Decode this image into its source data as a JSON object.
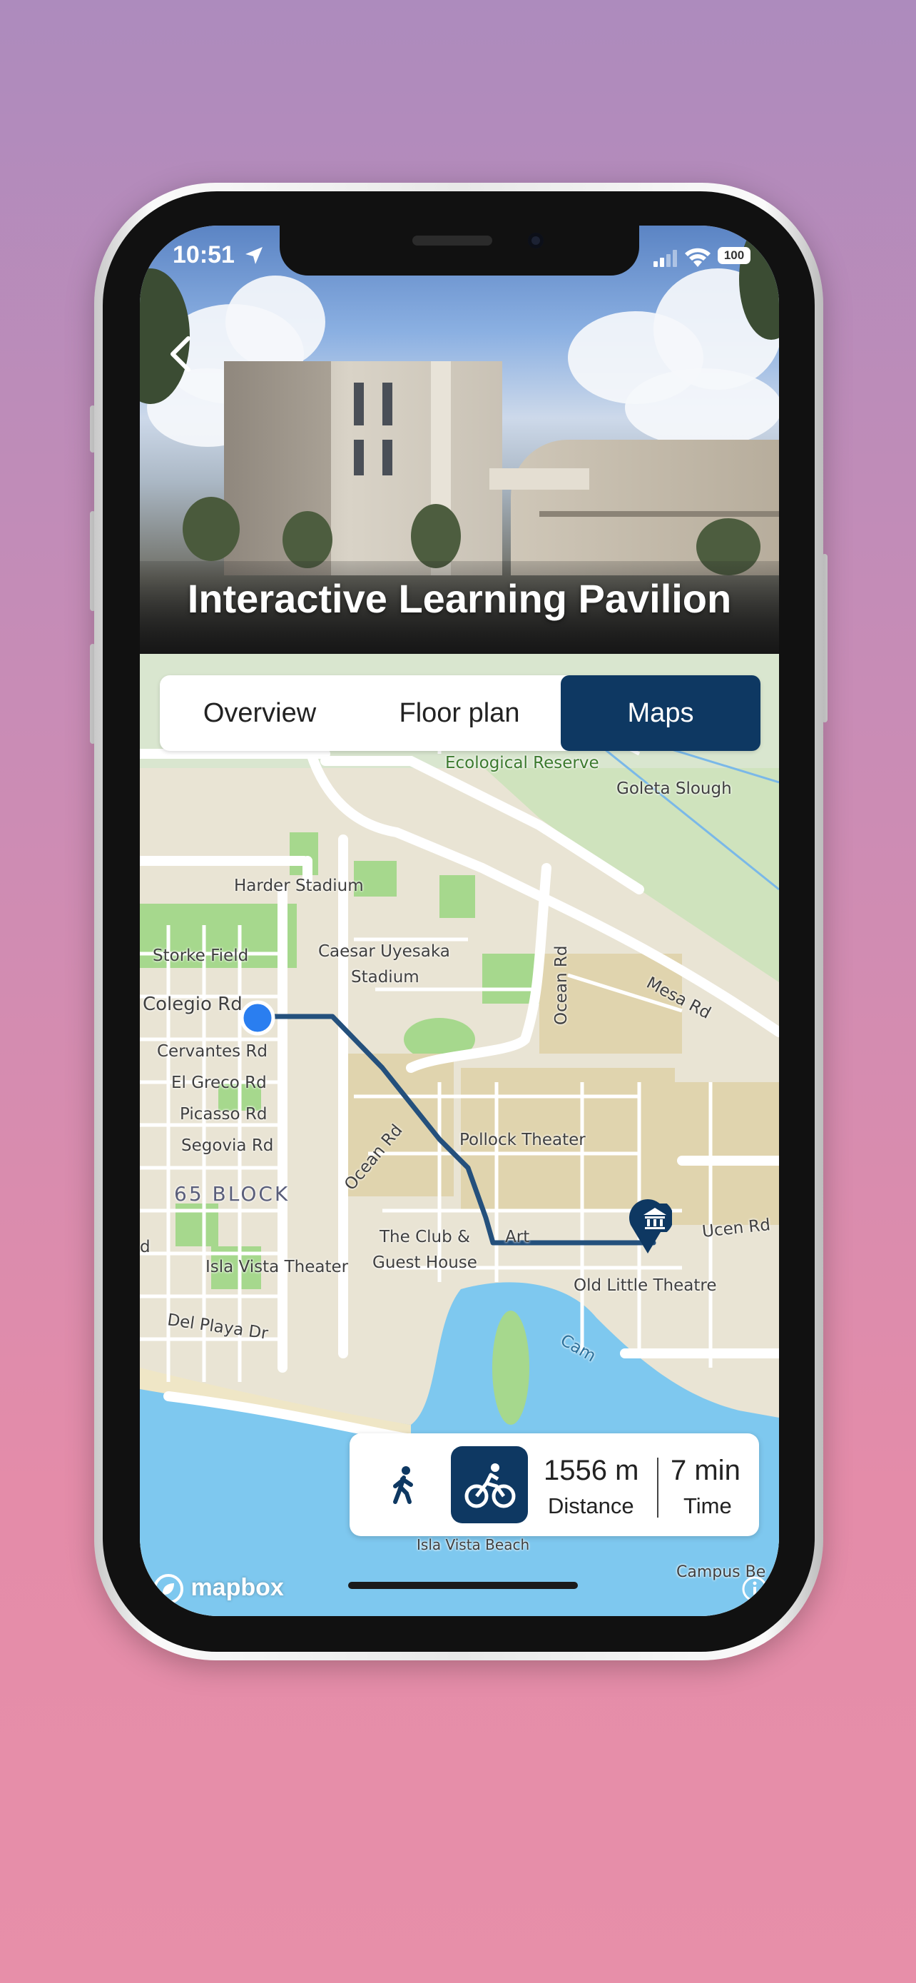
{
  "status": {
    "time": "10:51",
    "battery": "100"
  },
  "hero": {
    "title": "Interactive Learning Pavilion"
  },
  "tabs": [
    {
      "label": "Overview",
      "active": false
    },
    {
      "label": "Floor plan",
      "active": false
    },
    {
      "label": "Maps",
      "active": true
    }
  ],
  "map": {
    "labels": {
      "ecological_reserve": "Ecological Reserve",
      "goleta_slough": "Goleta Slough",
      "harder_stadium": "Harder Stadium",
      "storke_field": "Storke Field",
      "caesar_uyesaka_1": "Caesar Uyesaka",
      "caesar_uyesaka_2": "Stadium",
      "ocean_rd_1": "Ocean Rd",
      "ocean_rd_2": "Ocean Rd",
      "mesa_rd": "Mesa Rd",
      "colegio_rd": "Colegio Rd",
      "cervantes_rd": "Cervantes Rd",
      "el_greco_rd": "El Greco Rd",
      "picasso_rd": "Picasso Rd",
      "segovia_rd": "Segovia Rd",
      "block_65": "65 BLOCK",
      "pollock_theater": "Pollock Theater",
      "club_1": "The Club &",
      "club_2": "Guest House",
      "art": "Art",
      "ucen_rd": "Ucen Rd",
      "isla_vista_theater": "Isla Vista Theater",
      "old_little_theatre": "Old Little Theatre",
      "del_playa_dr": "Del Playa Dr",
      "campus_lagoon": "Cam",
      "isla_vista_beach": "Isla Vista Beach",
      "campus_beach": "Campus Be",
      "edge_d": "d"
    },
    "attribution": "mapbox"
  },
  "route_info": {
    "distance_value": "1556 m",
    "distance_label": "Distance",
    "time_value": "7 min",
    "time_label": "Time",
    "selected_mode": "bike"
  },
  "colors": {
    "accent": "#0e3862",
    "route": "#24507c",
    "user_dot": "#2a7ef0"
  }
}
